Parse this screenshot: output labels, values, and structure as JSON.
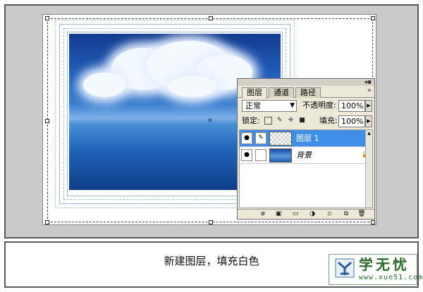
{
  "canvas": {
    "image_description": "blue sea and sky with white clouds"
  },
  "layers_panel": {
    "tabs": [
      {
        "label": "图层",
        "active": true
      },
      {
        "label": "通道",
        "active": false
      },
      {
        "label": "路径",
        "active": false
      }
    ],
    "blend_mode": "正常",
    "opacity_label": "不透明度:",
    "opacity_value": "100%",
    "lock_label": "锁定:",
    "fill_label": "填充:",
    "fill_value": "100%",
    "layers": [
      {
        "name": "图层 1",
        "selected": true,
        "visible": true
      },
      {
        "name": "背景",
        "selected": false,
        "visible": true,
        "locked": true
      }
    ],
    "selected_color": "#3f8fe8"
  },
  "caption": "新建图层，填充白色",
  "logo": {
    "title": "学无忧",
    "url": "www.xue51.com"
  }
}
